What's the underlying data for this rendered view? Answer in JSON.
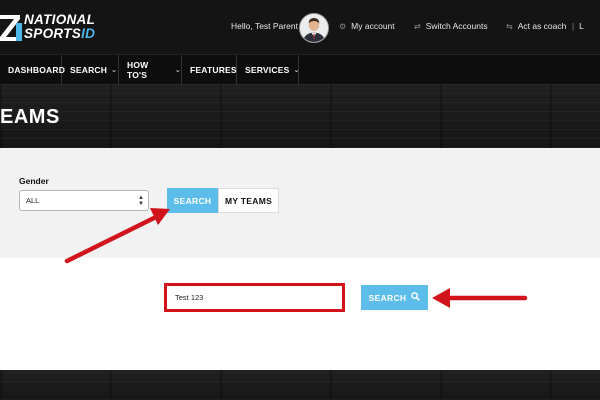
{
  "header": {
    "logo_line1": "NATIONAL",
    "logo_line2a": "SPORTS",
    "logo_line2b": "ID",
    "greeting": "Hello, Test Parent",
    "links": [
      {
        "label": "My account",
        "icon": "gear-icon"
      },
      {
        "label": "Switch Accounts",
        "icon": "switch-icon"
      },
      {
        "label": "Act as coach",
        "icon": "arrows-icon"
      },
      {
        "label": "L",
        "icon": "logout-icon"
      }
    ]
  },
  "nav": {
    "items": [
      {
        "label": "DASHBOARD",
        "has_dropdown": false
      },
      {
        "label": "SEARCH",
        "has_dropdown": true
      },
      {
        "label": "HOW TO'S",
        "has_dropdown": true
      },
      {
        "label": "FEATURES",
        "has_dropdown": false
      },
      {
        "label": "SERVICES",
        "has_dropdown": true
      }
    ]
  },
  "page": {
    "title": "EAMS"
  },
  "filters": {
    "gender_label": "Gender",
    "gender_value": "ALL",
    "tabs": [
      {
        "label": "SEARCH",
        "active": true
      },
      {
        "label": "MY TEAMS",
        "active": false
      }
    ]
  },
  "search": {
    "input_value": "Test 123",
    "button_label": "SEARCH"
  },
  "colors": {
    "accent": "#5cbdea",
    "annotation_red": "#d1131b",
    "header_bg": "#141414"
  }
}
